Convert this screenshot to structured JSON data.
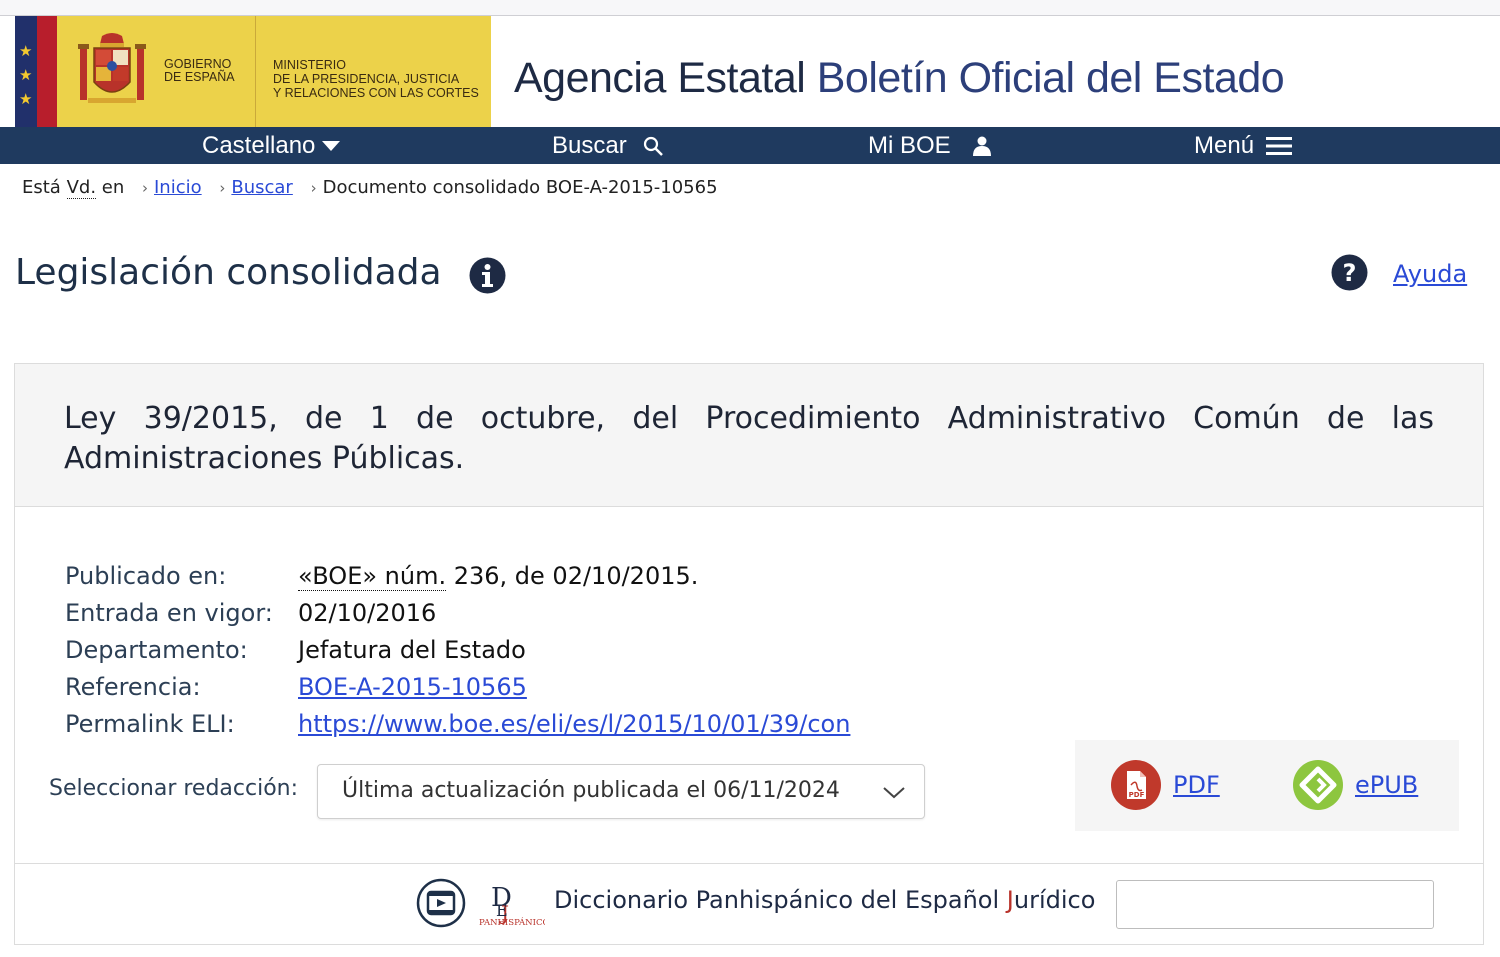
{
  "header": {
    "gobierno": "GOBIERNO\nDE ESPAÑA",
    "ministerio": "MINISTERIO\nDE LA PRESIDENCIA, JUSTICIA\nY RELACIONES CON LAS CORTES",
    "agency_part1": "Agencia Estatal",
    "agency_part2": "Boletín Oficial del Estado"
  },
  "nav": {
    "language": "Castellano",
    "search": "Buscar",
    "my_boe": "Mi BOE",
    "menu": "Menú"
  },
  "breadcrumb": {
    "prefix_1": "Está",
    "prefix_abbr": "Vd.",
    "prefix_2": "en",
    "home": "Inicio",
    "search": "Buscar",
    "current": "Documento consolidado BOE-A-2015-10565"
  },
  "page": {
    "title": "Legislación consolidada",
    "help": "Ayuda"
  },
  "document": {
    "title": "Ley 39/2015, de 1 de octubre, del Procedimiento Administrativo Común de las Administraciones Públicas.",
    "meta": [
      {
        "label": "Publicado en:",
        "value_abbr": "«BOE» núm.",
        "value": " 236, de 02/10/2015."
      },
      {
        "label": "Entrada en vigor:",
        "value": "02/10/2016"
      },
      {
        "label": "Departamento:",
        "value": "Jefatura del Estado"
      },
      {
        "label": "Referencia:",
        "value": "BOE-A-2015-10565"
      },
      {
        "label": "Permalink ELI:",
        "value": "https://www.boe.es/eli/es/l/2015/10/01/39/con"
      }
    ],
    "select_label": "Seleccionar redacción:",
    "select_value": "Última actualización publicada el 06/11/2024",
    "downloads": {
      "pdf": "PDF",
      "epub": "ePUB"
    },
    "dictionary": {
      "text_before": "Diccionario Panhispánico del Español ",
      "text_j": "J",
      "text_after": "urídico",
      "logo_caption": "PANHISPÁNICO"
    }
  },
  "colors": {
    "nav_bg": "#1f3a5f",
    "link": "#2a4ad6",
    "gov_yellow": "#ecd24a",
    "pdf_red": "#c0392b",
    "epub_green": "#8dc63f"
  }
}
